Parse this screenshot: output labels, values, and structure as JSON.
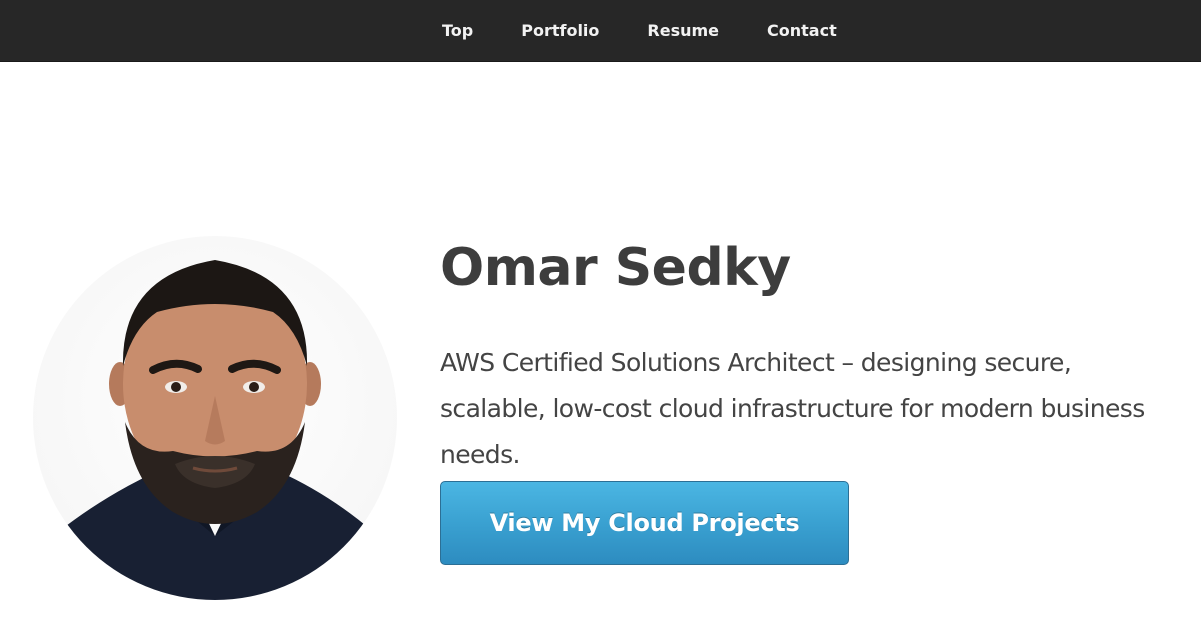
{
  "nav": {
    "items": [
      {
        "label": "Top"
      },
      {
        "label": "Portfolio"
      },
      {
        "label": "Resume"
      },
      {
        "label": "Contact"
      }
    ]
  },
  "hero": {
    "name": "Omar Sedky",
    "tagline": "AWS Certified Solutions Architect – designing secure, scalable, low-cost cloud infrastructure for modern business needs.",
    "cta_label": "View My Cloud Projects"
  },
  "colors": {
    "navbar_bg": "#272727",
    "button_blue": "#3aa1d1",
    "heading_text": "#3d3d3d"
  },
  "icons": {
    "profile_photo": "profile-photo"
  }
}
